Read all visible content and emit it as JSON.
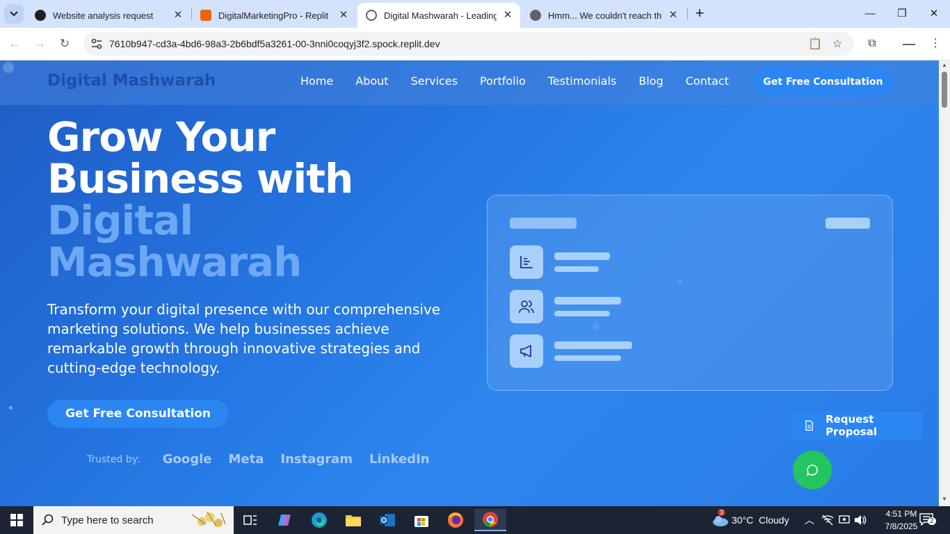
{
  "browser": {
    "tabs": [
      {
        "label": "Website analysis request",
        "active": false
      },
      {
        "label": "DigitalMarketingPro - Replit",
        "active": false
      },
      {
        "label": "Digital Mashwarah - Leading Di",
        "active": true
      },
      {
        "label": "Hmm... We couldn't reach this a",
        "active": false
      }
    ],
    "url": "7610b947-cd3a-4bd6-98a3-2b6bdf5a3261-00-3nni0coqyj3f2.spock.replit.dev",
    "accent": "#d3e3fd"
  },
  "site": {
    "brand": "Digital Mashwarah",
    "nav": [
      "Home",
      "About",
      "Services",
      "Portfolio",
      "Testimonials",
      "Blog",
      "Contact"
    ],
    "nav_cta": "Get Free Consultation",
    "hero": {
      "title_line1": "Grow Your",
      "title_line2": "Business with",
      "title_accent1": "Digital",
      "title_accent2": "Mashwarah",
      "subtitle": "Transform your digital presence with our comprehensive marketing solutions. We help businesses achieve remarkable growth through innovative strategies and cutting-edge technology.",
      "cta": "Get Free Consultation"
    },
    "trusted_label": "Trusted by:",
    "trusted_logos": [
      "Google",
      "Meta",
      "Instagram",
      "LinkedIn"
    ],
    "card_icons": [
      "chart-icon",
      "users-icon",
      "megaphone-icon"
    ],
    "proposal_button": "Request Proposal",
    "colors": {
      "primary": "#2b86f2",
      "chat": "#22c55e",
      "accent_text": "#6ea8f5"
    }
  },
  "taskbar": {
    "search_placeholder": "Type here to search",
    "weather_temp": "30°C",
    "weather_desc": "Cloudy",
    "weather_badge": "3",
    "time": "4:51 PM",
    "date": "7/8/2025",
    "notification_count": "2"
  }
}
